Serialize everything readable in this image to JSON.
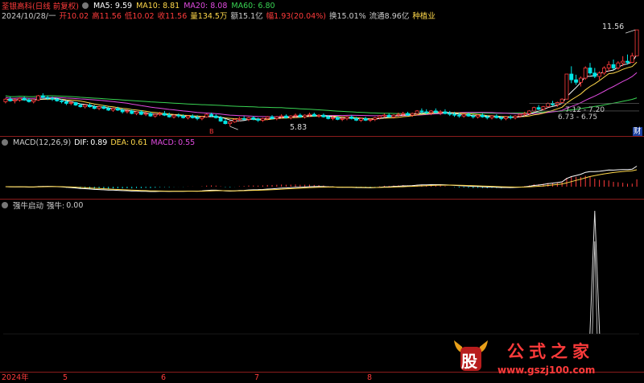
{
  "header": {
    "stock_title": "荃银高科(日线 前复权)",
    "ma": [
      {
        "label": "MA5:",
        "value": "9.59",
        "color": "#ffffff"
      },
      {
        "label": "MA10:",
        "value": "8.81",
        "color": "#ffd84a"
      },
      {
        "label": "MA20:",
        "value": "8.08",
        "color": "#e14be0"
      },
      {
        "label": "MA60:",
        "value": "6.80",
        "color": "#39d353"
      }
    ]
  },
  "info_line": {
    "date": "2024/10/28/一",
    "items": [
      {
        "label": "开",
        "value": "10.02",
        "color": "#ff3b3b"
      },
      {
        "label": "高",
        "value": "11.56",
        "color": "#ff3b3b"
      },
      {
        "label": "低",
        "value": "10.02",
        "color": "#ff3b3b"
      },
      {
        "label": "收",
        "value": "11.56",
        "color": "#ff3b3b"
      },
      {
        "label": "量",
        "value": "134.5万",
        "color": "#ffd84a"
      },
      {
        "label": "额",
        "value": "15.1亿",
        "color": "#cccccc"
      },
      {
        "label": "幅",
        "value": "1.93(20.04%)",
        "color": "#ff3b3b"
      },
      {
        "label": "换",
        "value": "15.01%",
        "color": "#cccccc"
      },
      {
        "label": "流通",
        "value": "8.96亿",
        "color": "#cccccc"
      },
      {
        "label": "",
        "value": "种植业",
        "color": "#ffd84a"
      }
    ]
  },
  "annotations": {
    "high": "11.56",
    "low": "5.83",
    "range1": "7.12 - 7.20",
    "range2": "6.73 - 6.75",
    "corner": "财",
    "marker": "B"
  },
  "macd": {
    "title": "MACD(12,26,9)",
    "dif_label": "DIF:",
    "dif": "0.89",
    "dea_label": "DEA:",
    "dea": "0.61",
    "macd_label": "MACD:",
    "macd": "0.55"
  },
  "indicator": {
    "title": "强牛启动",
    "label": "强牛:",
    "value": "0.00"
  },
  "x_axis": [
    "2024年",
    "5",
    "6",
    "7",
    "8"
  ],
  "watermark": {
    "logo": "股",
    "title": "公式之家",
    "url": "www.gszj100.com"
  },
  "colors": {
    "up": "#ff3b3b",
    "down": "#00e5e5",
    "ma5": "#ffffff",
    "ma10": "#ffd84a",
    "ma20": "#e14be0",
    "ma60": "#39d353",
    "separator": "#8b1c1c"
  },
  "chart_data": [
    {
      "type": "candlestick",
      "title": "荃银高科(日线 前复权)",
      "x_ticks": [
        "2024年",
        "5",
        "6",
        "7",
        "8"
      ],
      "annotated_high": 11.56,
      "annotated_low": 5.83,
      "ohlc": [
        [
          7.3,
          7.5,
          7.2,
          7.45
        ],
        [
          7.45,
          7.6,
          7.3,
          7.35
        ],
        [
          7.35,
          7.5,
          7.2,
          7.4
        ],
        [
          7.4,
          7.55,
          7.3,
          7.5
        ],
        [
          7.5,
          7.6,
          7.35,
          7.4
        ],
        [
          7.4,
          7.5,
          7.25,
          7.3
        ],
        [
          7.3,
          7.45,
          7.2,
          7.4
        ],
        [
          7.4,
          7.7,
          7.35,
          7.65
        ],
        [
          7.65,
          7.8,
          7.5,
          7.55
        ],
        [
          7.55,
          7.65,
          7.4,
          7.5
        ],
        [
          7.5,
          7.6,
          7.35,
          7.45
        ],
        [
          7.45,
          7.55,
          7.3,
          7.35
        ],
        [
          7.35,
          7.45,
          7.2,
          7.3
        ],
        [
          7.3,
          7.4,
          7.1,
          7.2
        ],
        [
          7.2,
          7.35,
          7.1,
          7.25
        ],
        [
          7.25,
          7.3,
          7.05,
          7.1
        ],
        [
          7.1,
          7.2,
          6.95,
          7.0
        ],
        [
          7.0,
          7.15,
          6.9,
          7.1
        ],
        [
          7.1,
          7.2,
          6.95,
          7.0
        ],
        [
          7.0,
          7.1,
          6.85,
          6.9
        ],
        [
          6.9,
          7.05,
          6.8,
          7.0
        ],
        [
          7.0,
          7.1,
          6.85,
          6.9
        ],
        [
          6.9,
          7.0,
          6.75,
          6.8
        ],
        [
          6.8,
          6.95,
          6.7,
          6.9
        ],
        [
          6.9,
          7.0,
          6.75,
          6.8
        ],
        [
          6.8,
          6.9,
          6.6,
          6.7
        ],
        [
          6.7,
          6.85,
          6.6,
          6.75
        ],
        [
          6.75,
          6.85,
          6.55,
          6.6
        ],
        [
          6.6,
          6.75,
          6.5,
          6.7
        ],
        [
          6.7,
          6.8,
          6.5,
          6.55
        ],
        [
          6.55,
          6.7,
          6.45,
          6.6
        ],
        [
          6.6,
          6.7,
          6.4,
          6.45
        ],
        [
          6.45,
          6.6,
          6.35,
          6.55
        ],
        [
          6.55,
          6.7,
          6.45,
          6.6
        ],
        [
          6.6,
          6.75,
          6.45,
          6.5
        ],
        [
          6.5,
          6.65,
          6.35,
          6.4
        ],
        [
          6.4,
          6.55,
          6.3,
          6.5
        ],
        [
          6.5,
          6.6,
          6.35,
          6.45
        ],
        [
          6.45,
          6.55,
          6.3,
          6.35
        ],
        [
          6.35,
          6.5,
          6.25,
          6.45
        ],
        [
          6.45,
          6.55,
          6.3,
          6.35
        ],
        [
          6.35,
          6.5,
          6.2,
          6.3
        ],
        [
          6.3,
          6.45,
          6.2,
          6.4
        ],
        [
          6.4,
          6.6,
          6.35,
          6.55
        ],
        [
          6.55,
          6.65,
          6.4,
          6.45
        ],
        [
          6.45,
          6.55,
          6.3,
          6.35
        ],
        [
          6.35,
          6.45,
          6.1,
          6.15
        ],
        [
          6.15,
          6.3,
          5.95,
          6.0
        ],
        [
          6.0,
          6.15,
          5.83,
          6.1
        ],
        [
          6.1,
          6.3,
          6.05,
          6.25
        ],
        [
          6.25,
          6.4,
          6.15,
          6.3
        ],
        [
          6.3,
          6.45,
          6.2,
          6.25
        ],
        [
          6.25,
          6.4,
          6.15,
          6.35
        ],
        [
          6.35,
          6.45,
          6.2,
          6.25
        ],
        [
          6.25,
          6.35,
          6.1,
          6.2
        ],
        [
          6.2,
          6.35,
          6.1,
          6.3
        ],
        [
          6.3,
          6.45,
          6.2,
          6.4
        ],
        [
          6.4,
          6.5,
          6.25,
          6.3
        ],
        [
          6.3,
          6.45,
          6.2,
          6.4
        ],
        [
          6.4,
          6.55,
          6.3,
          6.45
        ],
        [
          6.45,
          6.55,
          6.3,
          6.35
        ],
        [
          6.35,
          6.5,
          6.25,
          6.45
        ],
        [
          6.45,
          6.6,
          6.35,
          6.5
        ],
        [
          6.5,
          6.6,
          6.35,
          6.4
        ],
        [
          6.4,
          6.55,
          6.3,
          6.5
        ],
        [
          6.5,
          6.65,
          6.4,
          6.55
        ],
        [
          6.55,
          6.65,
          6.4,
          6.45
        ],
        [
          6.45,
          6.55,
          6.35,
          6.5
        ],
        [
          6.5,
          6.6,
          6.35,
          6.4
        ],
        [
          6.4,
          6.5,
          6.25,
          6.3
        ],
        [
          6.3,
          6.45,
          6.2,
          6.35
        ],
        [
          6.35,
          6.45,
          6.2,
          6.25
        ],
        [
          6.25,
          6.4,
          6.15,
          6.3
        ],
        [
          6.3,
          6.45,
          6.2,
          6.4
        ],
        [
          6.4,
          6.5,
          6.25,
          6.3
        ],
        [
          6.3,
          6.4,
          6.15,
          6.2
        ],
        [
          6.2,
          6.35,
          6.1,
          6.3
        ],
        [
          6.3,
          6.4,
          6.15,
          6.2
        ],
        [
          6.2,
          6.3,
          6.1,
          6.25
        ],
        [
          6.25,
          6.4,
          6.15,
          6.35
        ],
        [
          6.35,
          6.5,
          6.25,
          6.45
        ],
        [
          6.45,
          6.6,
          6.35,
          6.5
        ],
        [
          6.5,
          6.6,
          6.35,
          6.4
        ],
        [
          6.4,
          6.55,
          6.3,
          6.5
        ],
        [
          6.5,
          6.65,
          6.4,
          6.55
        ],
        [
          6.55,
          6.7,
          6.45,
          6.6
        ],
        [
          6.6,
          6.7,
          6.45,
          6.5
        ],
        [
          6.5,
          6.65,
          6.4,
          6.6
        ],
        [
          6.6,
          6.8,
          6.5,
          6.75
        ],
        [
          6.75,
          6.9,
          6.6,
          6.7
        ],
        [
          6.7,
          6.85,
          6.55,
          6.65
        ],
        [
          6.65,
          6.8,
          6.5,
          6.75
        ],
        [
          6.75,
          6.9,
          6.6,
          6.65
        ],
        [
          6.65,
          6.8,
          6.5,
          6.7
        ],
        [
          6.7,
          6.85,
          6.55,
          6.6
        ],
        [
          6.6,
          6.75,
          6.45,
          6.55
        ],
        [
          6.55,
          6.7,
          6.4,
          6.5
        ],
        [
          6.5,
          6.65,
          6.35,
          6.45
        ],
        [
          6.45,
          6.6,
          6.35,
          6.55
        ],
        [
          6.55,
          6.65,
          6.4,
          6.45
        ],
        [
          6.45,
          6.55,
          6.3,
          6.4
        ],
        [
          6.4,
          6.55,
          6.3,
          6.5
        ],
        [
          6.5,
          6.6,
          6.35,
          6.4
        ],
        [
          6.4,
          6.5,
          6.25,
          6.35
        ],
        [
          6.35,
          6.5,
          6.25,
          6.45
        ],
        [
          6.45,
          6.55,
          6.3,
          6.35
        ],
        [
          6.35,
          6.45,
          6.2,
          6.3
        ],
        [
          6.3,
          6.45,
          6.2,
          6.4
        ],
        [
          6.4,
          6.5,
          6.25,
          6.35
        ],
        [
          6.35,
          6.5,
          6.25,
          6.45
        ],
        [
          6.45,
          6.6,
          6.35,
          6.55
        ],
        [
          6.55,
          6.7,
          6.45,
          6.6
        ],
        [
          6.6,
          6.8,
          6.5,
          6.75
        ],
        [
          6.75,
          7.0,
          6.7,
          6.95
        ],
        [
          6.95,
          7.1,
          6.8,
          6.85
        ],
        [
          6.85,
          7.05,
          6.8,
          7.0
        ],
        [
          7.0,
          7.25,
          6.95,
          7.2
        ],
        [
          7.2,
          7.35,
          7.05,
          7.12
        ],
        [
          7.12,
          7.3,
          7.0,
          7.25
        ],
        [
          7.25,
          7.5,
          7.2,
          7.45
        ],
        [
          7.45,
          8.94,
          7.45,
          8.94
        ],
        [
          8.94,
          9.4,
          8.4,
          8.6
        ],
        [
          8.6,
          8.9,
          8.3,
          8.45
        ],
        [
          8.45,
          8.8,
          8.2,
          8.7
        ],
        [
          8.7,
          9.4,
          8.6,
          9.3
        ],
        [
          9.3,
          9.6,
          8.9,
          9.0
        ],
        [
          9.0,
          9.3,
          8.7,
          8.8
        ],
        [
          8.8,
          9.1,
          8.6,
          9.0
        ],
        [
          9.0,
          9.4,
          8.9,
          9.3
        ],
        [
          9.3,
          9.7,
          9.1,
          9.5
        ],
        [
          9.5,
          9.8,
          9.2,
          9.3
        ],
        [
          9.3,
          9.7,
          9.2,
          9.6
        ],
        [
          9.6,
          10.0,
          9.4,
          9.7
        ],
        [
          9.7,
          10.1,
          9.5,
          9.63
        ],
        [
          9.63,
          10.2,
          9.6,
          10.02
        ],
        [
          10.02,
          11.56,
          10.02,
          11.56
        ]
      ],
      "ma_series": [
        {
          "name": "MA5",
          "last": 9.59
        },
        {
          "name": "MA10",
          "last": 8.81
        },
        {
          "name": "MA20",
          "last": 8.08
        },
        {
          "name": "MA60",
          "last": 6.8
        }
      ]
    },
    {
      "type": "macd",
      "title": "MACD(12,26,9)",
      "last": {
        "DIF": 0.89,
        "DEA": 0.61,
        "MACD": 0.55
      }
    },
    {
      "type": "line",
      "title": "强牛启动",
      "series_label": "强牛",
      "last_value": 0.0,
      "spike_index": 126
    }
  ]
}
